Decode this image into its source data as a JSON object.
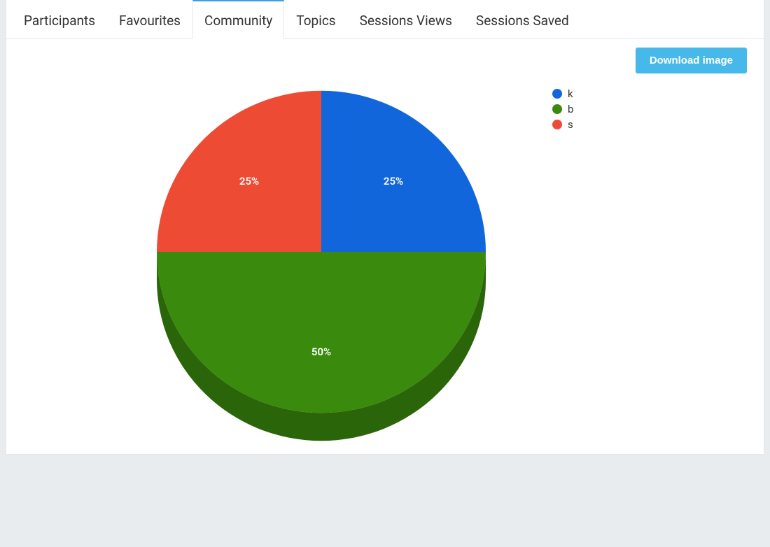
{
  "tabs": {
    "items": [
      {
        "label": "Participants",
        "active": false
      },
      {
        "label": "Favourites",
        "active": false
      },
      {
        "label": "Community",
        "active": true
      },
      {
        "label": "Topics",
        "active": false
      },
      {
        "label": "Sessions Views",
        "active": false
      },
      {
        "label": "Sessions Saved",
        "active": false
      }
    ]
  },
  "toolbar": {
    "download_label": "Download image"
  },
  "chart_data": {
    "type": "pie",
    "series": [
      {
        "name": "k",
        "value": 25,
        "label": "25%",
        "color": "#1166dc",
        "dark": "#0d4fa8"
      },
      {
        "name": "b",
        "value": 50,
        "label": "50%",
        "color": "#3a8a0e",
        "dark": "#2a650a"
      },
      {
        "name": "s",
        "value": 25,
        "label": "25%",
        "color": "#ee4b35",
        "dark": "#b83a29"
      }
    ],
    "title": "",
    "legend_position": "right"
  }
}
